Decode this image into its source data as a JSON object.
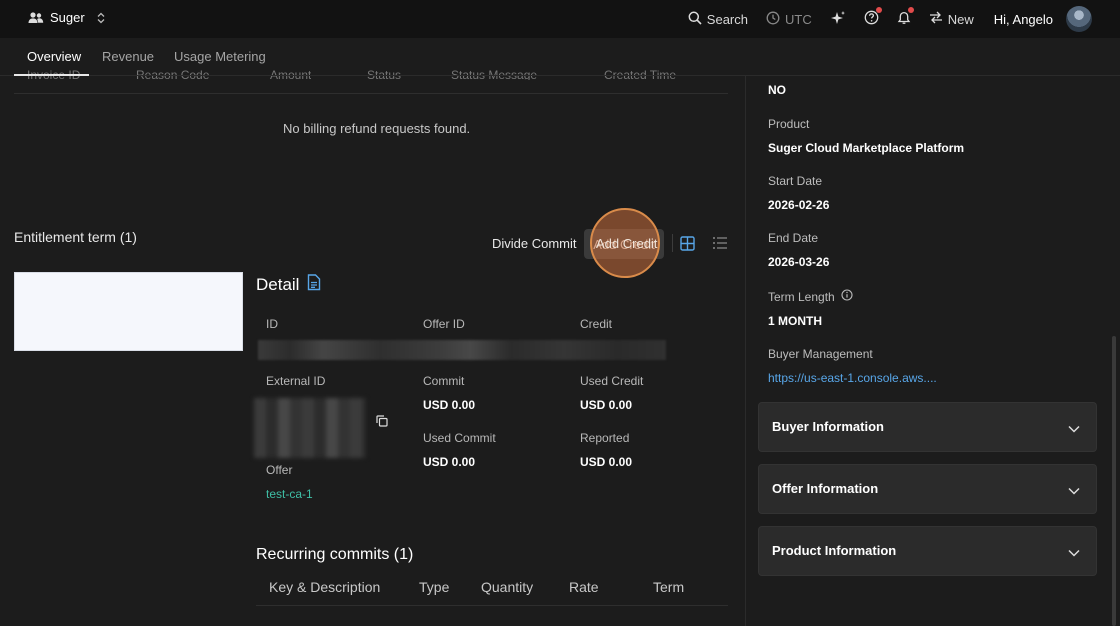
{
  "topbar": {
    "workspace": "Suger",
    "search": "Search",
    "timezone": "UTC",
    "new_label": "New",
    "greeting": "Hi, Angelo"
  },
  "tabs": [
    {
      "label": "Overview",
      "active": true
    },
    {
      "label": "Revenue",
      "active": false
    },
    {
      "label": "Usage Metering",
      "active": false
    }
  ],
  "refunds": {
    "columns": [
      "Invoice ID",
      "Reason Code",
      "Amount",
      "Status",
      "Status Message",
      "Created Time"
    ],
    "empty_text": "No billing refund requests found."
  },
  "entitlement": {
    "title": "Entitlement term (1)",
    "divide_commit": "Divide Commit",
    "add_credit": "Add Credit"
  },
  "detail": {
    "title": "Detail",
    "id_label": "ID",
    "offer_id_label": "Offer ID",
    "credit_label": "Credit",
    "external_id_label": "External ID",
    "commit_label": "Commit",
    "commit_value": "USD 0.00",
    "used_credit_label": "Used Credit",
    "used_credit_value": "USD 0.00",
    "used_commit_label": "Used Commit",
    "used_commit_value": "USD 0.00",
    "reported_label": "Reported",
    "reported_value": "USD 0.00",
    "offer_label": "Offer",
    "offer_value": "test-ca-1"
  },
  "recurring": {
    "title": "Recurring commits (1)",
    "columns": [
      "Key & Description",
      "Type",
      "Quantity",
      "Rate",
      "Term"
    ]
  },
  "right_panel": {
    "top_value": "NO",
    "product_label": "Product",
    "product_value": "Suger Cloud Marketplace Platform",
    "start_label": "Start Date",
    "start_value": "2026-02-26",
    "end_label": "End Date",
    "end_value": "2026-03-26",
    "term_label": "Term Length",
    "term_value": "1 MONTH",
    "buyer_mgmt_label": "Buyer Management",
    "buyer_mgmt_link": "https://us-east-1.console.aws....",
    "sections": [
      "Buyer Information",
      "Offer Information",
      "Product Information"
    ]
  },
  "colors": {
    "accent_link": "#58a6e8",
    "offer_link": "#3fbfa6",
    "highlight": "#d98b4a",
    "notification": "#e24b4b"
  }
}
